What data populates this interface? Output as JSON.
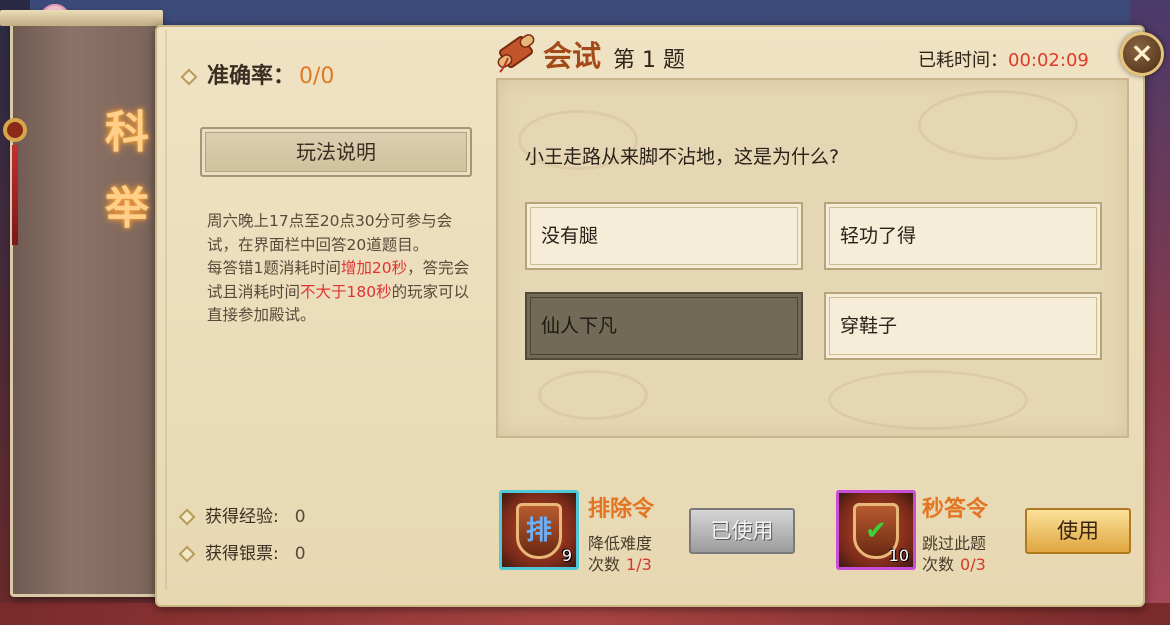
{
  "scroll": {
    "title": "科举"
  },
  "left": {
    "accuracy_label": "准确率：",
    "accuracy_value": "0/0",
    "rules_button": "玩法说明",
    "rules": {
      "p1": "周六晚上17点至20点30分可参与会试，在界面栏中回答20道题目。",
      "p2a": "每答错1题消耗时间",
      "p2b": "增加20秒",
      "p2c": "，答完会试且消耗时间",
      "p2d": "不大于180秒",
      "p2e": "的玩家可以直接参加殿试。"
    },
    "rewards": [
      {
        "label": "获得经验:",
        "value": "0"
      },
      {
        "label": "获得银票:",
        "value": "0"
      }
    ]
  },
  "header": {
    "title": "会试",
    "question_number": "第 1 题",
    "time_label": "已耗时间：",
    "time_value": "00:02:09",
    "close": "×"
  },
  "question": {
    "text": "小王走路从来脚不沾地，这是为什么?",
    "answers": [
      "没有腿",
      "轻功了得",
      "仙人下凡",
      "穿鞋子"
    ],
    "selected_index": 2
  },
  "items": [
    {
      "name": "排除令",
      "desc": "降低难度",
      "times_label": "次数",
      "times_value": "1/3",
      "count": "9",
      "glyph": "排",
      "button": "已使用",
      "icon": "shield-exclude-icon"
    },
    {
      "name": "秒答令",
      "desc": "跳过此题",
      "times_label": "次数",
      "times_value": "0/3",
      "count": "10",
      "glyph": "✔",
      "button": "使用",
      "icon": "shield-check-icon"
    }
  ],
  "colors": {
    "accent": "#e07a22",
    "highlight": "#e03434",
    "frame_cyan": "#4ec8d8",
    "frame_purple": "#c84ed8"
  }
}
